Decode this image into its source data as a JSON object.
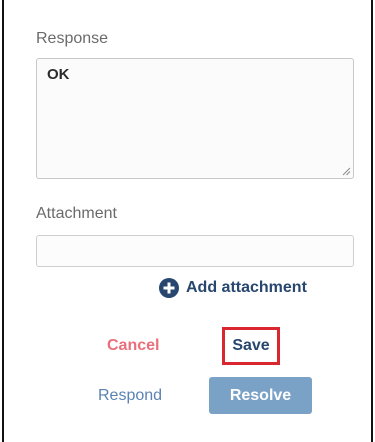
{
  "response": {
    "label": "Response",
    "value": "OK"
  },
  "attachment": {
    "label": "Attachment",
    "value": "",
    "add_label": "Add attachment"
  },
  "actions": {
    "cancel_label": "Cancel",
    "save_label": "Save",
    "respond_label": "Respond",
    "resolve_label": "Resolve"
  },
  "colors": {
    "primary": "#27476e",
    "cancel": "#e8707a",
    "highlight_border": "#d9262f",
    "resolve_bg": "#7aa1c6",
    "respond": "#5a83b3"
  },
  "icons": {
    "add_attachment": "plus-circle-icon",
    "textarea_resize": "resize-grip-icon"
  }
}
